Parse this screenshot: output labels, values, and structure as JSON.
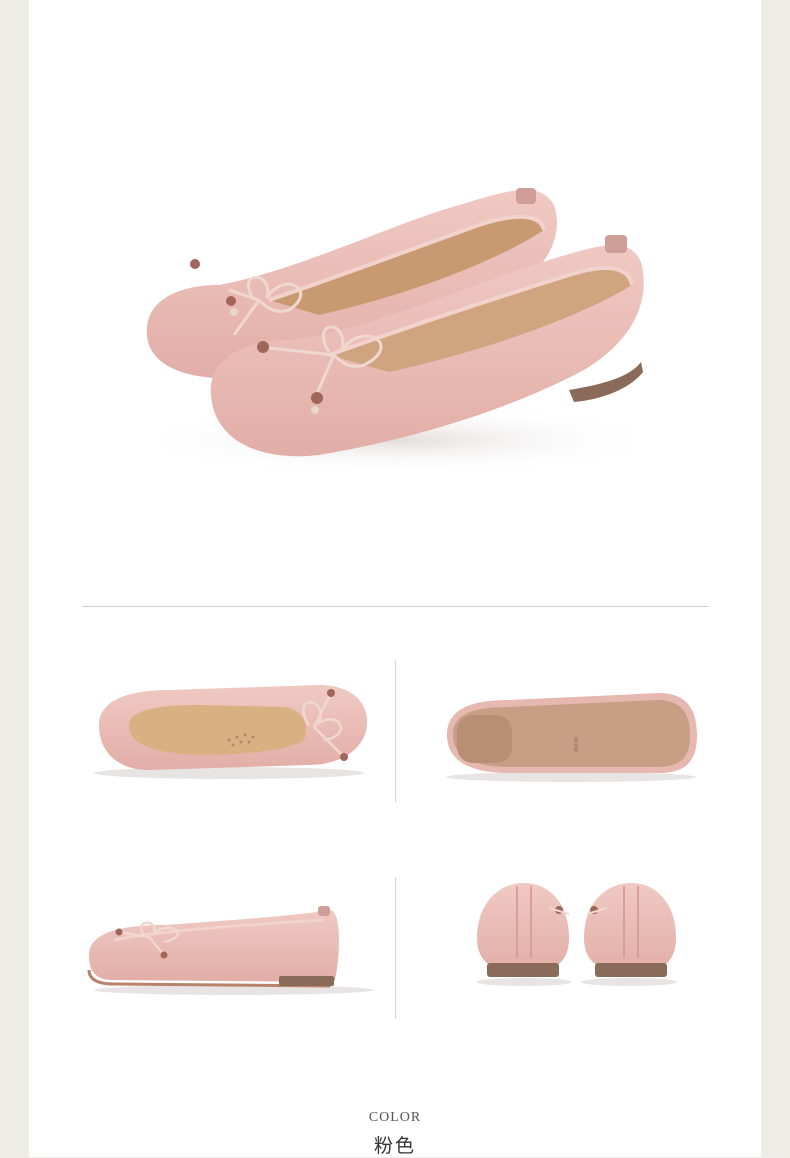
{
  "caption": {
    "label_en": "COLOR",
    "label_cn": "粉色"
  },
  "product": {
    "color_hex": "#e9b9b3",
    "views": [
      "hero-pair",
      "top-view",
      "sole-view",
      "side-view",
      "back-view"
    ]
  }
}
